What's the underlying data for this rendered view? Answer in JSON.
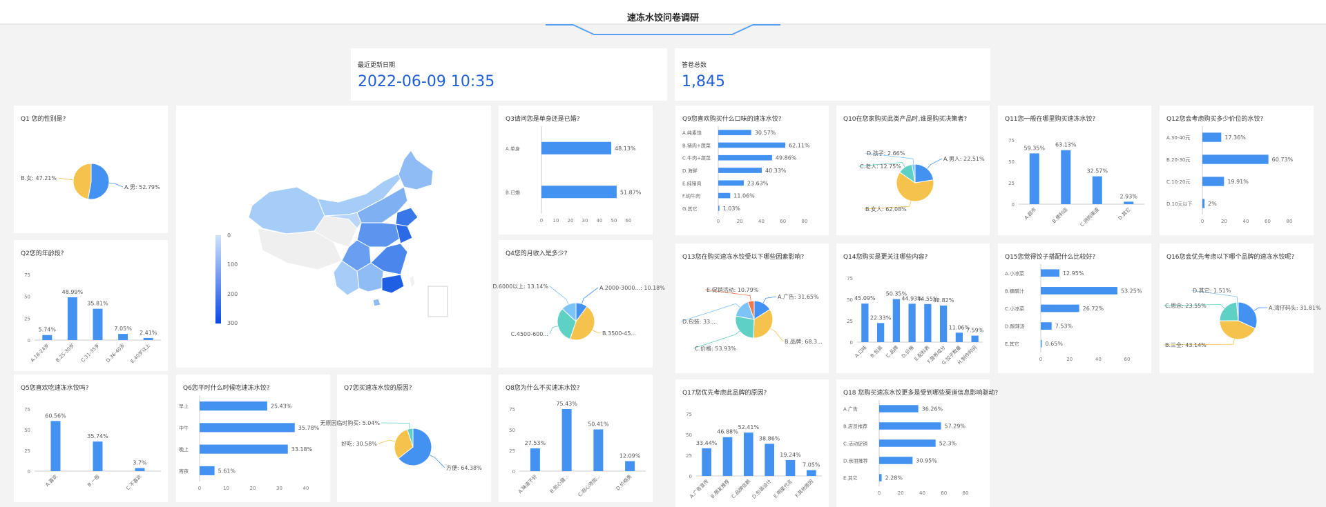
{
  "header": {
    "title": "速冻水饺问卷调研"
  },
  "stats": [
    {
      "label": "最近更新日期",
      "value": "2022-06-09 10:35"
    },
    {
      "label": "答卷总数",
      "value": "1,845"
    }
  ],
  "colors": {
    "blue": "#4392f1",
    "yellow": "#f5c24c",
    "teal": "#5fd0c4",
    "orange": "#f0784a",
    "sky": "#7cc4f8"
  },
  "map": {
    "legend_ticks": [
      "0",
      "100",
      "200",
      "300"
    ]
  },
  "chart_data": [
    {
      "id": "q1",
      "type": "pie",
      "title": "Q1 您的性别是?",
      "slices": [
        {
          "label": "A.男: 52.79%",
          "value": 52.79,
          "color": "#4392f1"
        },
        {
          "label": "B.女: 47.21%",
          "value": 47.21,
          "color": "#f5c24c"
        }
      ]
    },
    {
      "id": "q2",
      "type": "bar",
      "title": "Q2您的年龄段?",
      "categories": [
        "A.18-24岁",
        "B.25-30岁",
        "C.31-35岁",
        "D.36-40岁",
        "E.40岁以上"
      ],
      "values": [
        5.74,
        48.99,
        35.81,
        7.05,
        2.41
      ],
      "labels": [
        "5.74%",
        "48.99%",
        "35.81%",
        "7.05%",
        "2.41%"
      ],
      "ylim": [
        0,
        75
      ],
      "yticks": [
        "0",
        "25",
        "50",
        "75"
      ]
    },
    {
      "id": "q3",
      "type": "hbar",
      "title": "Q3请问您是单身还是已婚?",
      "categories": [
        "A.单身",
        "B.已婚"
      ],
      "values": [
        48.13,
        51.87
      ],
      "labels": [
        "48.13%",
        "51.87%"
      ],
      "xlim": [
        0,
        60
      ],
      "xticks": [
        "0",
        "10",
        "20",
        "30",
        "40",
        "50",
        "60"
      ]
    },
    {
      "id": "q4",
      "type": "pie",
      "title": "Q4您的月收入是多少?",
      "slices": [
        {
          "label": "A.2000-3000...: 10.18%",
          "value": 10.18,
          "color": "#4392f1"
        },
        {
          "label": "B.3500-45...",
          "value": 45.0,
          "color": "#f5c24c"
        },
        {
          "label": "C.4500-600...",
          "value": 31.68,
          "color": "#5fd0c4"
        },
        {
          "label": "D.6000以上: 13.14%",
          "value": 13.14,
          "color": "#7cc4f8"
        }
      ]
    },
    {
      "id": "q5",
      "type": "bar",
      "title": "Q5您喜欢吃速冻水饺吗?",
      "categories": [
        "A.喜欢",
        "B.一般",
        "C.不喜欢"
      ],
      "values": [
        60.56,
        35.74,
        3.7
      ],
      "labels": [
        "60.56%",
        "35.74%",
        "3.7%"
      ],
      "ylim": [
        0,
        75
      ],
      "yticks": [
        "0",
        "25",
        "50",
        "75"
      ]
    },
    {
      "id": "q6",
      "type": "hbar",
      "title": "Q6您平时什么时候吃速冻水饺?",
      "categories": [
        "早上",
        "中午",
        "晚上",
        "宵夜"
      ],
      "values": [
        25.43,
        35.78,
        33.18,
        5.61
      ],
      "labels": [
        "25.43%",
        "35.78%",
        "33.18%",
        "5.61%"
      ],
      "xlim": [
        0,
        40
      ],
      "xticks": [
        "0",
        "10",
        "20",
        "30",
        "40"
      ]
    },
    {
      "id": "q7",
      "type": "pie",
      "title": "Q7您买速冻水饺的原因?",
      "slices": [
        {
          "label": "方便: 64.38%",
          "value": 64.38,
          "color": "#4392f1"
        },
        {
          "label": "好吃: 30.58%",
          "value": 30.58,
          "color": "#f5c24c"
        },
        {
          "label": "无原因临时购买: 5.04%",
          "value": 5.04,
          "color": "#5fd0c4"
        }
      ]
    },
    {
      "id": "q8",
      "type": "bar",
      "title": "Q8您为什么不买速冻水饺?",
      "categories": [
        "A.味道不好",
        "B.担心健...",
        "C.担心添加...",
        "D.价格贵"
      ],
      "values": [
        27.53,
        75.43,
        50.41,
        12.09
      ],
      "labels": [
        "27.53%",
        "75.43%",
        "50.41%",
        "12.09%"
      ],
      "ylim": [
        0,
        75
      ],
      "yticks": [
        "0",
        "25",
        "50",
        "75"
      ]
    },
    {
      "id": "q9",
      "type": "hbar",
      "title": "Q9您喜欢购买什么口味的速冻水饺?",
      "categories": [
        "A.纯素馅",
        "B.猪肉+蔬菜",
        "C.牛肉+蔬菜",
        "D.海鲜",
        "E.纯猪肉",
        "F.纯牛肉",
        "G.其它"
      ],
      "values": [
        30.57,
        62.11,
        49.86,
        40.33,
        23.63,
        11.06,
        1.03
      ],
      "labels": [
        "30.57%",
        "62.11%",
        "49.86%",
        "40.33%",
        "23.63%",
        "11.06%",
        "1.03%"
      ],
      "xlim": [
        0,
        80
      ],
      "xticks": [
        "0",
        "20",
        "40",
        "60",
        "80"
      ]
    },
    {
      "id": "q10",
      "type": "pie",
      "title": "Q10在您家购买此类产品时,谁是购买决策者?",
      "slices": [
        {
          "label": "A.男人: 22.51%",
          "value": 22.51,
          "color": "#4392f1"
        },
        {
          "label": "B.女人: 62.08%",
          "value": 62.08,
          "color": "#f5c24c"
        },
        {
          "label": "C.老人: 12.75%",
          "value": 12.75,
          "color": "#5fd0c4"
        },
        {
          "label": "D.孩子: 2.66%",
          "value": 2.66,
          "color": "#7cc4f8"
        }
      ]
    },
    {
      "id": "q11",
      "type": "bar",
      "title": "Q11您一般在哪里购买速冻水饺?",
      "categories": [
        "A.超市",
        "B.便利店",
        "C.网购渠道",
        "D.其它"
      ],
      "values": [
        59.35,
        63.13,
        32.57,
        2.93
      ],
      "labels": [
        "59.35%",
        "63.13%",
        "32.57%",
        "2.93%"
      ],
      "ylim": [
        0,
        75
      ],
      "yticks": [
        "0",
        "25",
        "50",
        "75"
      ]
    },
    {
      "id": "q12",
      "type": "hbar",
      "title": "Q12您会考虑购买多少价位的水饺?",
      "categories": [
        "A.30-40元",
        "B.20-30元",
        "C.10-20元",
        "D.10元以下"
      ],
      "values": [
        17.36,
        60.73,
        19.91,
        2
      ],
      "labels": [
        "17.36%",
        "60.73%",
        "19.91%",
        "2%"
      ],
      "xlim": [
        0,
        80
      ],
      "xticks": [
        "0",
        "20",
        "40",
        "60",
        "80"
      ]
    },
    {
      "id": "q13",
      "type": "pie",
      "title": "Q13您在购买速冻水饺受以下哪些因素影响?",
      "slices": [
        {
          "label": "A.广告: 31.65%",
          "value": 31.65,
          "color": "#4392f1"
        },
        {
          "label": "B.品牌: 68.3...",
          "value": 68.3,
          "color": "#f5c24c"
        },
        {
          "label": "C.价格: 53.93%",
          "value": 53.93,
          "color": "#5fd0c4"
        },
        {
          "label": "D.包装: 33....",
          "value": 33.0,
          "color": "#7cc4f8"
        },
        {
          "label": "E.促销活动: 10.79%",
          "value": 10.79,
          "color": "#f0784a"
        }
      ]
    },
    {
      "id": "q14",
      "type": "bar",
      "title": "Q14您购买是更关注哪些内容?",
      "categories": [
        "A.口味",
        "B.包装",
        "C.品牌",
        "D.价格",
        "E.配料表",
        "F.营养成分",
        "G.饺子数量",
        "H.制作时间"
      ],
      "values": [
        45.09,
        22.33,
        50.35,
        44.93,
        44.55,
        42.82,
        11.06,
        7.59
      ],
      "labels": [
        "45.09%",
        "22.33%",
        "50.35%",
        "44.93%",
        "44.55%",
        "42.82%",
        "11.06%",
        "7.59%"
      ],
      "ylim": [
        0,
        75
      ],
      "yticks": [
        "0",
        "25",
        "50",
        "75"
      ]
    },
    {
      "id": "q15",
      "type": "hbar",
      "title": "Q15您觉得饺子搭配什么比较好?",
      "categories": [
        "A.小凉菜",
        "B.糖醋汁",
        "C.小凉菜",
        "D.酸辣汤",
        "E.其它"
      ],
      "values": [
        12.95,
        53.25,
        26.72,
        7.53,
        0.65
      ],
      "labels": [
        "12.95%",
        "53.25%",
        "26.72%",
        "7.53%",
        "0.65%"
      ],
      "xlim": [
        0,
        60
      ],
      "xticks": [
        "0",
        "20",
        "40",
        "60"
      ]
    },
    {
      "id": "q16",
      "type": "pie",
      "title": "Q16您会优先考虑以下哪个品牌的速冻水饺呢?",
      "slices": [
        {
          "label": "A.湾仔码头: 31.81%",
          "value": 31.81,
          "color": "#4392f1"
        },
        {
          "label": "B.三全: 43.14%",
          "value": 43.14,
          "color": "#f5c24c"
        },
        {
          "label": "C.思念: 23.55%",
          "value": 23.55,
          "color": "#5fd0c4"
        },
        {
          "label": "D.其它: 1.51%",
          "value": 1.51,
          "color": "#7cc4f8"
        }
      ]
    },
    {
      "id": "q17",
      "type": "bar",
      "title": "Q17您优先考虑此品牌的原因?",
      "categories": [
        "A.广告宣传",
        "B.朋友推荐",
        "C.品牌信赖",
        "D.包装设计",
        "E.明星代言",
        "F.其他原因"
      ],
      "values": [
        33.44,
        46.88,
        52.41,
        38.86,
        19.24,
        7.05
      ],
      "labels": [
        "33.44%",
        "46.88%",
        "52.41%",
        "38.86%",
        "19.24%",
        "7.05%"
      ],
      "ylim": [
        0,
        75
      ],
      "yticks": [
        "0",
        "25",
        "50",
        "75"
      ]
    },
    {
      "id": "q18",
      "type": "hbar",
      "title": "Q18 您购买速冻水饺更多是受到哪些渠道信息影响驱动?",
      "categories": [
        "A.广告",
        "B.店员推荐",
        "C.活动促销",
        "D.亲朋推荐",
        "E.其它"
      ],
      "values": [
        36.26,
        57.29,
        52.3,
        30.95,
        2.28
      ],
      "labels": [
        "36.26%",
        "57.29%",
        "52.3%",
        "30.95%",
        "2.28%"
      ],
      "xlim": [
        0,
        80
      ],
      "xticks": [
        "0",
        "20",
        "40",
        "60",
        "80"
      ]
    }
  ]
}
